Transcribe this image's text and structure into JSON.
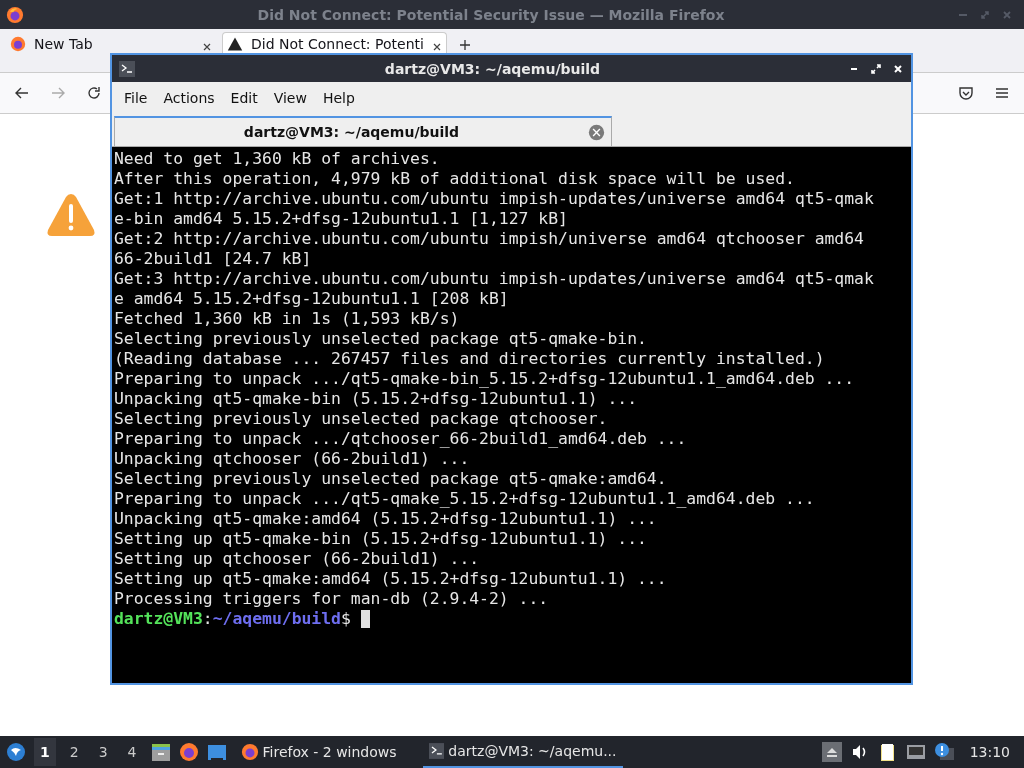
{
  "browser": {
    "title": "Did Not Connect: Potential Security Issue — Mozilla Firefox",
    "tabs": [
      {
        "label": "New Tab",
        "selected": false,
        "kind": "firefox"
      },
      {
        "label": "Did Not Connect: Potenti",
        "selected": true,
        "kind": "warning"
      }
    ]
  },
  "terminal": {
    "title": "dartz@VM3: ~/aqemu/build",
    "menu": [
      "File",
      "Actions",
      "Edit",
      "View",
      "Help"
    ],
    "tabs": [
      {
        "label": "dartz@VM3: ~/aqemu/build",
        "selected": true
      }
    ],
    "lines": [
      "Need to get 1,360 kB of archives.",
      "After this operation, 4,979 kB of additional disk space will be used.",
      "Get:1 http://archive.ubuntu.com/ubuntu impish-updates/universe amd64 qt5-qmak",
      "e-bin amd64 5.15.2+dfsg-12ubuntu1.1 [1,127 kB]",
      "Get:2 http://archive.ubuntu.com/ubuntu impish/universe amd64 qtchooser amd64",
      "66-2build1 [24.7 kB]",
      "Get:3 http://archive.ubuntu.com/ubuntu impish-updates/universe amd64 qt5-qmak",
      "e amd64 5.15.2+dfsg-12ubuntu1.1 [208 kB]",
      "Fetched 1,360 kB in 1s (1,593 kB/s)",
      "Selecting previously unselected package qt5-qmake-bin.",
      "(Reading database ... 267457 files and directories currently installed.)",
      "Preparing to unpack .../qt5-qmake-bin_5.15.2+dfsg-12ubuntu1.1_amd64.deb ...",
      "Unpacking qt5-qmake-bin (5.15.2+dfsg-12ubuntu1.1) ...",
      "Selecting previously unselected package qtchooser.",
      "Preparing to unpack .../qtchooser_66-2build1_amd64.deb ...",
      "Unpacking qtchooser (66-2build1) ...",
      "Selecting previously unselected package qt5-qmake:amd64.",
      "Preparing to unpack .../qt5-qmake_5.15.2+dfsg-12ubuntu1.1_amd64.deb ...",
      "Unpacking qt5-qmake:amd64 (5.15.2+dfsg-12ubuntu1.1) ...",
      "Setting up qt5-qmake-bin (5.15.2+dfsg-12ubuntu1.1) ...",
      "Setting up qtchooser (66-2build1) ...",
      "Setting up qt5-qmake:amd64 (5.15.2+dfsg-12ubuntu1.1) ...",
      "Processing triggers for man-db (2.9.4-2) ..."
    ],
    "prompt": {
      "user": "dartz@VM3",
      "separator": ":",
      "path": "~/aqemu/build",
      "symbol": "$"
    }
  },
  "taskbar": {
    "workspaces": [
      {
        "label": "1",
        "selected": true
      },
      {
        "label": "2",
        "selected": false
      },
      {
        "label": "3",
        "selected": false
      },
      {
        "label": "4",
        "selected": false
      }
    ],
    "tasks": [
      {
        "label": "Firefox - 2 windows",
        "kind": "firefox",
        "selected": false
      },
      {
        "label": "dartz@VM3: ~/aqemu...",
        "kind": "terminal",
        "selected": true
      }
    ],
    "clock": "13:10"
  }
}
